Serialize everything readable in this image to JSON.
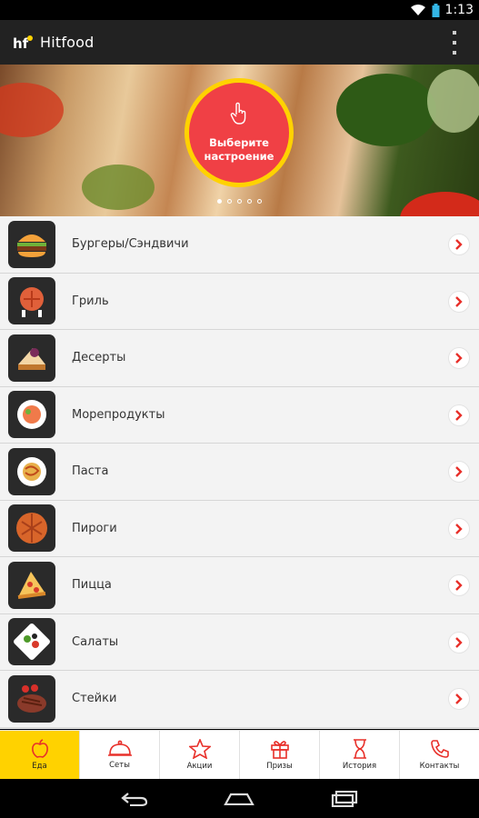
{
  "status_bar": {
    "time": "1:13"
  },
  "app": {
    "title": "Hitfood"
  },
  "hero": {
    "mood_label": "Выберите настроение",
    "slides": [
      1,
      0,
      0,
      0,
      0
    ]
  },
  "categories": [
    {
      "label": "Бургеры/Сэндвичи",
      "icon": "burger-icon"
    },
    {
      "label": "Гриль",
      "icon": "grill-icon"
    },
    {
      "label": "Десерты",
      "icon": "dessert-icon"
    },
    {
      "label": "Морепродукты",
      "icon": "seafood-icon"
    },
    {
      "label": "Паста",
      "icon": "pasta-icon"
    },
    {
      "label": "Пироги",
      "icon": "pie-icon"
    },
    {
      "label": "Пицца",
      "icon": "pizza-icon"
    },
    {
      "label": "Салаты",
      "icon": "salad-icon"
    },
    {
      "label": "Стейки",
      "icon": "steak-icon"
    }
  ],
  "tabs": [
    {
      "label": "Еда",
      "icon": "apple-icon",
      "active": true
    },
    {
      "label": "Сеты",
      "icon": "cloche-icon",
      "active": false
    },
    {
      "label": "Акции",
      "icon": "star-icon",
      "active": false
    },
    {
      "label": "Призы",
      "icon": "gift-icon",
      "active": false
    },
    {
      "label": "История",
      "icon": "hourglass-icon",
      "active": false
    },
    {
      "label": "Контакты",
      "icon": "phone-icon",
      "active": false
    }
  ],
  "colors": {
    "accent_red": "#f04045",
    "accent_yellow": "#ffd200",
    "action_bar": "#222222"
  }
}
